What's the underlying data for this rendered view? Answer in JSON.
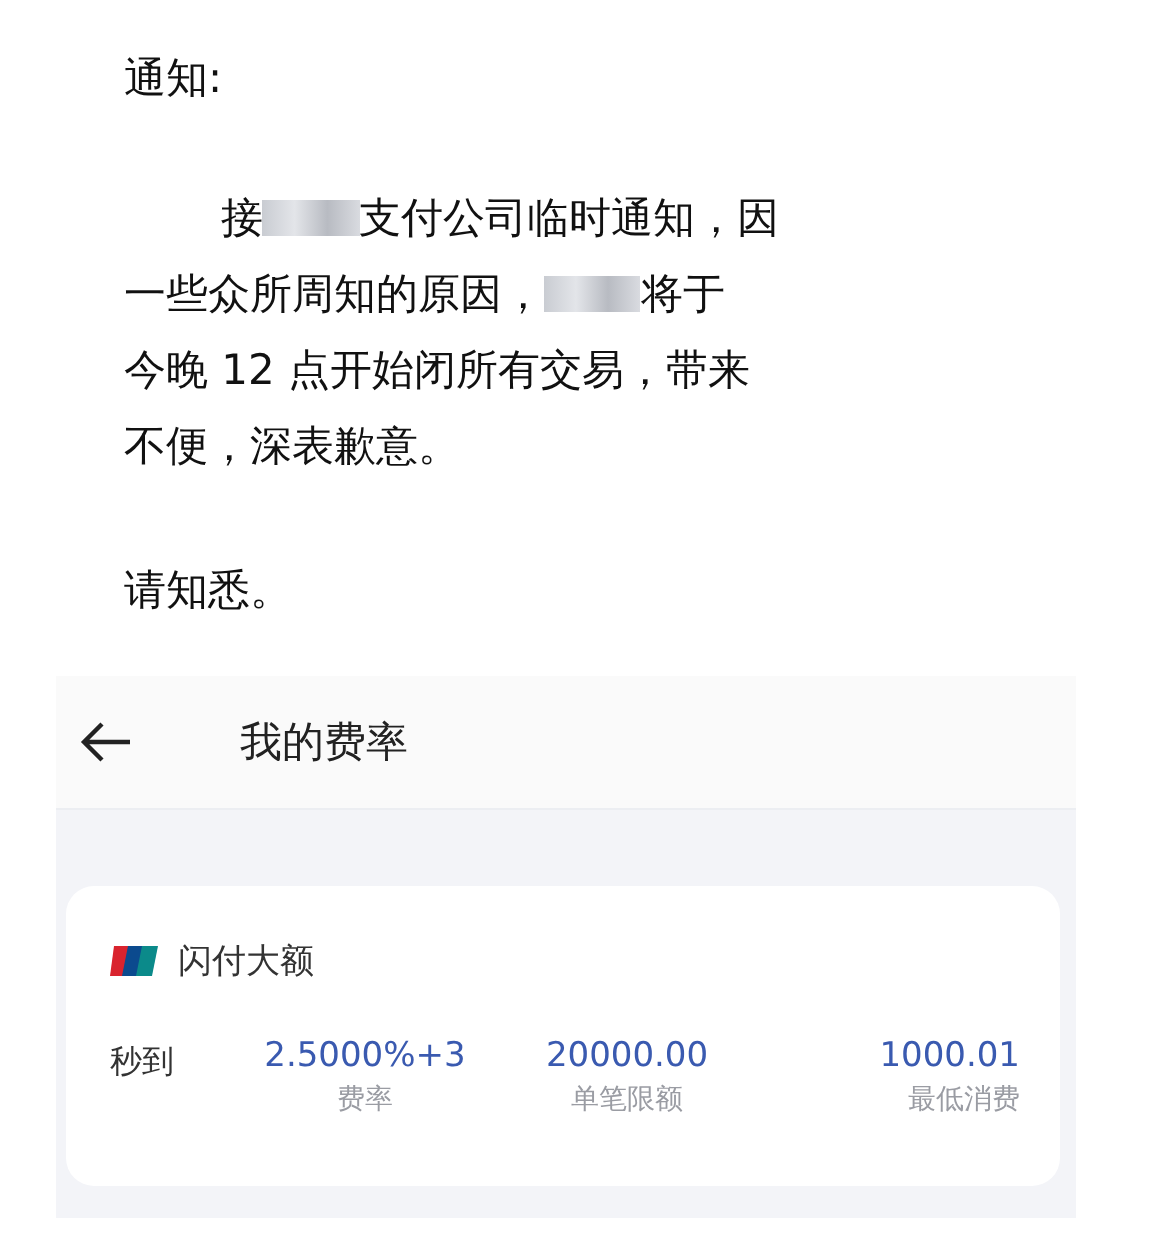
{
  "notice": {
    "heading": "通知:",
    "paragraph_lines": [
      [
        {
          "kind": "text",
          "text": "接"
        },
        {
          "kind": "redacted"
        },
        {
          "kind": "text",
          "text": "支付公司临时通知，因"
        }
      ],
      [
        {
          "kind": "text",
          "text": "一些众所周知的原因，"
        },
        {
          "kind": "redacted"
        },
        {
          "kind": "text",
          "text": "将于"
        }
      ],
      [
        {
          "kind": "text",
          "text": "今晚 12 点开始闭所有交易，带来"
        }
      ],
      [
        {
          "kind": "text",
          "text": "不便，深表歉意。"
        }
      ]
    ],
    "closing": "请知悉。"
  },
  "app": {
    "header": {
      "title": "我的费率"
    },
    "card": {
      "title": "闪付大额",
      "row_label": "秒到",
      "stats": [
        {
          "value": "2.5000%+3",
          "label": "费率"
        },
        {
          "value": "20000.00",
          "label": "单笔限额"
        },
        {
          "value": "1000.01",
          "label": "最低消费"
        }
      ]
    }
  }
}
